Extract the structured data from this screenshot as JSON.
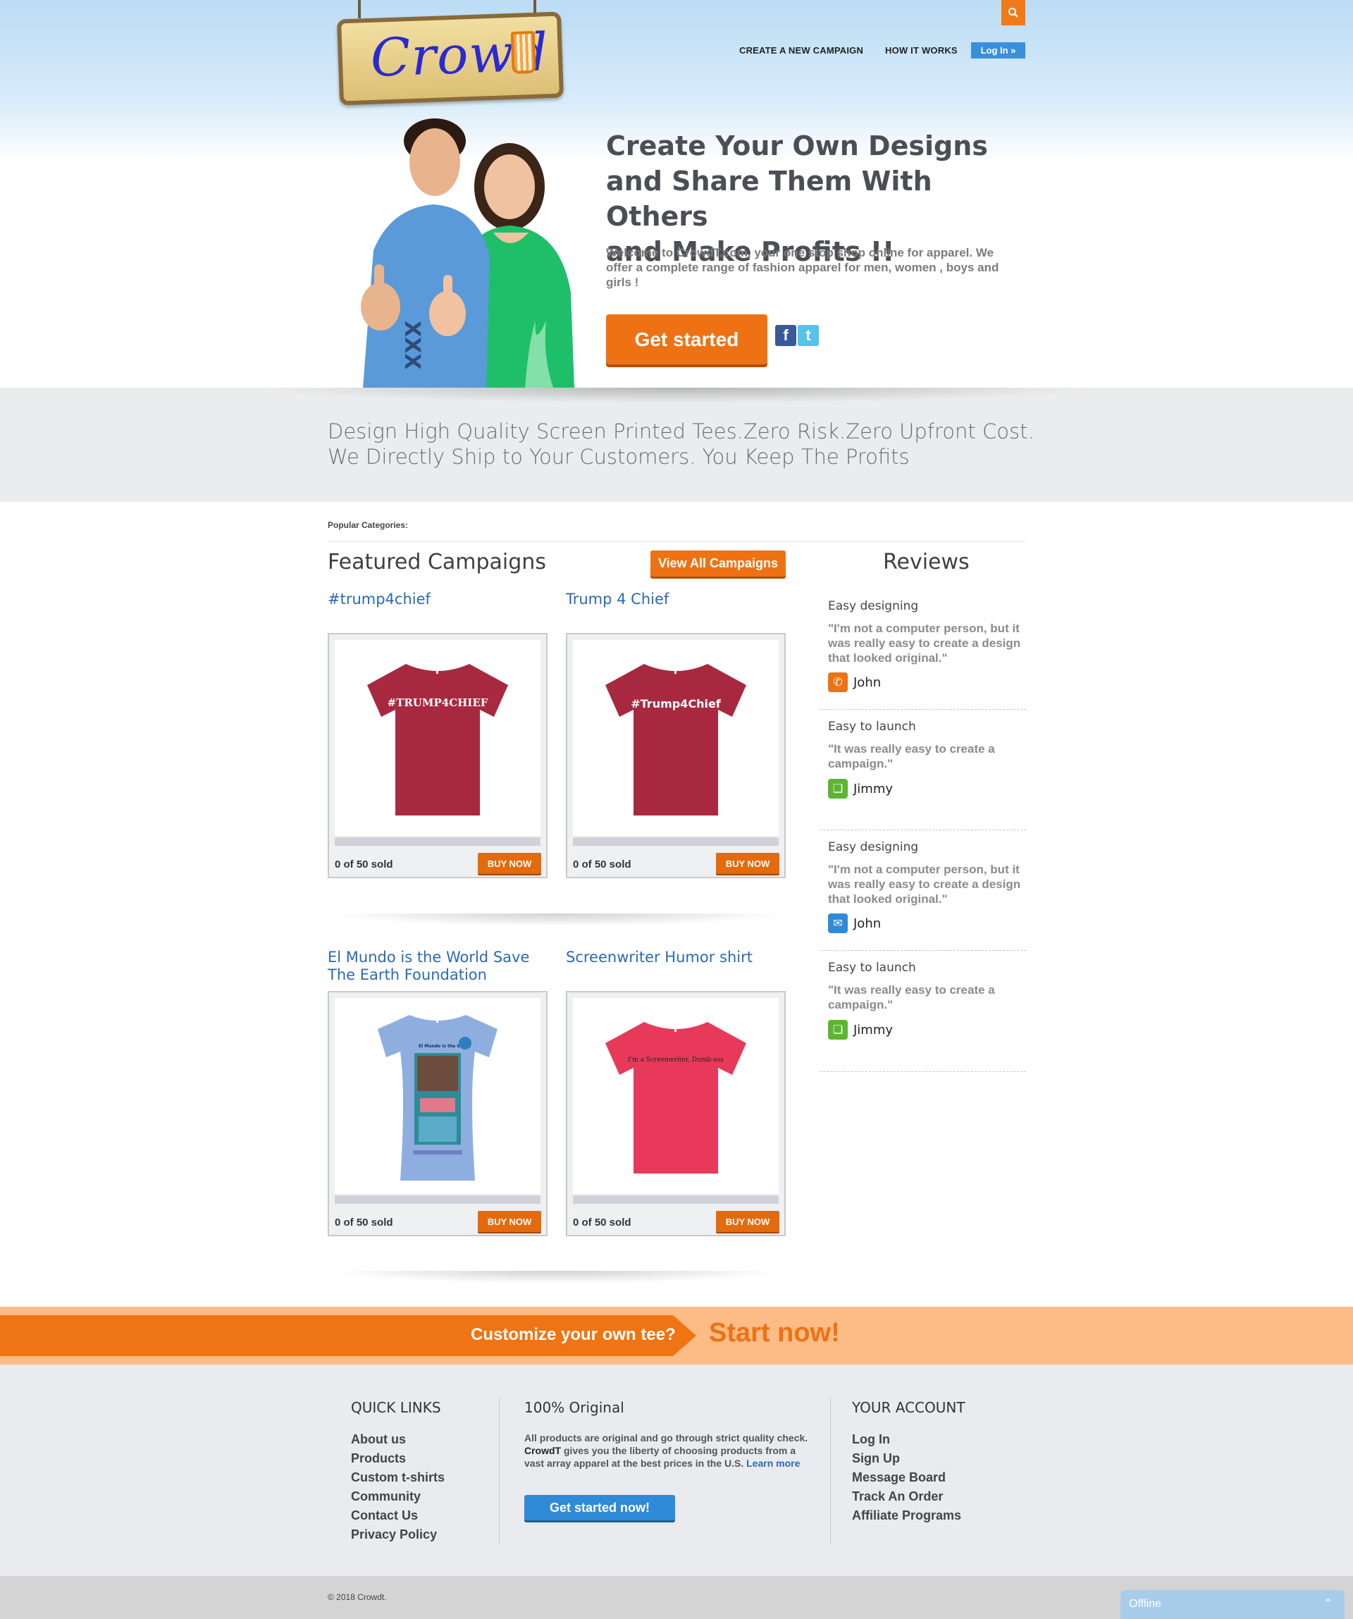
{
  "brand": {
    "logo_text": "Crowd"
  },
  "nav": {
    "create": "CREATE A NEW CAMPAIGN",
    "how": "HOW IT WORKS",
    "login": "Log In »"
  },
  "hero": {
    "title_1": "Create Your Own Designs",
    "title_2": "and Share Them With Others",
    "title_3": "and Make Profits !!",
    "subtitle": "Welcome to CrowdT.com, your one stop shop online for apparel. We offer a complete range of fashion apparel for men, women , boys and girls !",
    "cta": "Get started",
    "shirt_print": "XXX"
  },
  "tagline": {
    "line1": "Design High Quality Screen Printed Tees.Zero Risk.Zero Upfront Cost.",
    "line2": "We Directly Ship to Your Customers. You Keep The Profits"
  },
  "popular_categories": "Popular Categories:",
  "featured": {
    "title": "Featured Campaigns",
    "view_all": "View All Campaigns",
    "campaigns": [
      {
        "title": "#trump4chief",
        "shirt_text": "#TRUMP4CHIEF",
        "shirt_color": "#a8293f",
        "sold": "0 of 50 sold",
        "buy": "BUY NOW"
      },
      {
        "title": "Trump 4 Chief",
        "shirt_text": "#Trump4Chief",
        "shirt_color": "#a8293f",
        "sold": "0 of 50 sold",
        "buy": "BUY NOW"
      },
      {
        "title": "El Mundo is the World Save The Earth Foundation",
        "shirt_text": "El Mundo is the World",
        "shirt_color": "#8faee0",
        "sold": "0 of 50 sold",
        "buy": "BUY NOW"
      },
      {
        "title": "Screenwriter Humor shirt",
        "shirt_text": "I'm a Screenwriter, Dumb-ass",
        "shirt_color": "#e8395a",
        "sold": "0 of 50 sold",
        "buy": "BUY NOW"
      }
    ]
  },
  "reviews": {
    "title": "Reviews",
    "items": [
      {
        "head": "Easy designing",
        "quote": "\"I'm not a computer person, but it was really easy to create a design that looked original.\"",
        "name": "John",
        "icon": "phone-icon",
        "icon_glyph": "✆",
        "color": "#ee7213"
      },
      {
        "head": "Easy to launch",
        "quote": "\"It was really easy to create a campaign.\"",
        "name": "Jimmy",
        "icon": "chat-icon",
        "icon_glyph": "❏",
        "color": "#5cb531"
      },
      {
        "head": "Easy designing",
        "quote": "\"I'm not a computer person, but it was really easy to create a design that looked original.\"",
        "name": "John",
        "icon": "mail-icon",
        "icon_glyph": "✉",
        "color": "#2f8ad8"
      },
      {
        "head": "Easy to launch",
        "quote": "\"It was really easy to create a campaign.\"",
        "name": "Jimmy",
        "icon": "chat-icon",
        "icon_glyph": "❏",
        "color": "#5cb531"
      }
    ]
  },
  "cta_bar": {
    "question": "Customize your own tee?",
    "action": "Start now!"
  },
  "footer": {
    "quick_links": {
      "title": "QUICK LINKS",
      "items": [
        "About us",
        "Products",
        "Custom t-shirts",
        "Community",
        "Contact Us",
        "Privacy Policy"
      ]
    },
    "original": {
      "title": "100% Original",
      "text_a": "All products are original and go through strict quality check.",
      "brand": "CrowdT",
      "text_b": "gives you the liberty of choosing products from a vast array apparel at the best prices in the U.S.",
      "learn_more": "Learn more",
      "button": "Get started now!"
    },
    "account": {
      "title": "YOUR ACCOUNT",
      "items": [
        "Log In",
        "Sign Up",
        "Message Board",
        "Track An Order",
        "Affiliate Programs"
      ]
    },
    "copyright": "© 2018 Crowdt."
  },
  "chat": {
    "status": "Offline"
  }
}
